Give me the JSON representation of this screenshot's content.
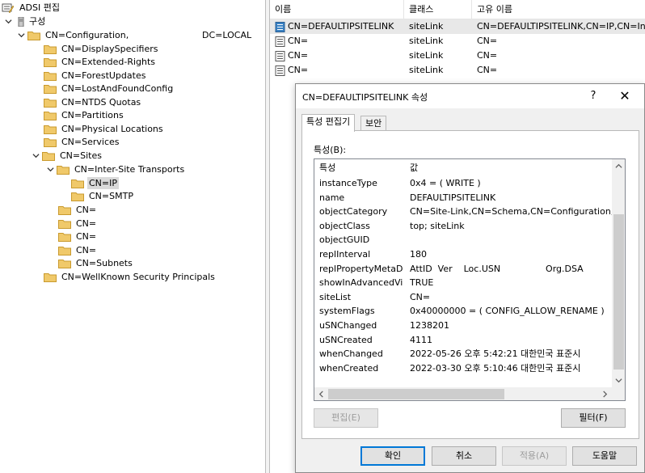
{
  "tree": {
    "root_label": "ADSI 편집",
    "nodes": [
      {
        "label": "구성",
        "suffix": ""
      },
      {
        "label": "CN=Configuration,",
        "suffix": "DC=LOCAL"
      },
      {
        "label": "CN=DisplaySpecifiers",
        "suffix": ""
      },
      {
        "label": "CN=Extended-Rights",
        "suffix": ""
      },
      {
        "label": "CN=ForestUpdates",
        "suffix": ""
      },
      {
        "label": "CN=LostAndFoundConfig",
        "suffix": ""
      },
      {
        "label": "CN=NTDS Quotas",
        "suffix": ""
      },
      {
        "label": "CN=Partitions",
        "suffix": ""
      },
      {
        "label": "CN=Physical Locations",
        "suffix": ""
      },
      {
        "label": "CN=Services",
        "suffix": ""
      },
      {
        "label": "CN=Sites",
        "suffix": ""
      },
      {
        "label": "CN=Inter-Site Transports",
        "suffix": ""
      },
      {
        "label": "CN=IP",
        "suffix": ""
      },
      {
        "label": "CN=SMTP",
        "suffix": ""
      },
      {
        "label": "CN=",
        "suffix": ""
      },
      {
        "label": "CN=",
        "suffix": ""
      },
      {
        "label": "CN=",
        "suffix": ""
      },
      {
        "label": "CN=",
        "suffix": ""
      },
      {
        "label": "CN=Subnets",
        "suffix": ""
      },
      {
        "label": "CN=WellKnown Security Principals",
        "suffix": ""
      }
    ]
  },
  "list": {
    "columns": [
      "이름",
      "클래스",
      "고유 이름"
    ],
    "rows": [
      {
        "name": "CN=DEFAULTIPSITELINK",
        "class": "siteLink",
        "dn": "CN=DEFAULTIPSITELINK,CN=IP,CN=Inter-"
      },
      {
        "name": "CN=",
        "class": "siteLink",
        "dn": "CN="
      },
      {
        "name": "CN=",
        "class": "siteLink",
        "dn": "CN="
      },
      {
        "name": "CN=",
        "class": "siteLink",
        "dn": "CN="
      }
    ]
  },
  "dialog": {
    "title": "CN=DEFAULTIPSITELINK 속성",
    "help": "?",
    "close": "✕",
    "tabs": [
      "특성 편집기",
      "보안"
    ],
    "attributes_label": "특성(B):",
    "grid_columns": [
      "특성",
      "값"
    ],
    "attributes": [
      {
        "name": "instanceType",
        "value": "0x4 = ( WRITE )"
      },
      {
        "name": "name",
        "value": "DEFAULTIPSITELINK"
      },
      {
        "name": "objectCategory",
        "value": "CN=Site-Link,CN=Schema,CN=Configuration,DC="
      },
      {
        "name": "objectClass",
        "value": "top; siteLink"
      },
      {
        "name": "objectGUID",
        "value": ""
      },
      {
        "name": "replInterval",
        "value": "180"
      },
      {
        "name": "replPropertyMetaD...",
        "value": "AttID  Ver    Loc.USN                Org.DSA"
      },
      {
        "name": "showInAdvancedVi...",
        "value": "TRUE"
      },
      {
        "name": "siteList",
        "value": "CN="
      },
      {
        "name": "systemFlags",
        "value": "0x40000000 = ( CONFIG_ALLOW_RENAME )"
      },
      {
        "name": "uSNChanged",
        "value": "1238201"
      },
      {
        "name": "uSNCreated",
        "value": "4111"
      },
      {
        "name": "whenChanged",
        "value": "2022-05-26 오후 5:42:21 대한민국 표준시"
      },
      {
        "name": "whenCreated",
        "value": "2022-03-30 오후 5:10:46 대한민국 표준시"
      }
    ],
    "edit_button": "편집(E)",
    "filter_button": "필터(F)",
    "ok_button": "확인",
    "cancel_button": "취소",
    "apply_button": "적용(A)",
    "help_button": "도움말"
  },
  "colors": {
    "folder": "#f0c96a",
    "selection": "#d9d9d9",
    "accent": "#0078d7"
  }
}
